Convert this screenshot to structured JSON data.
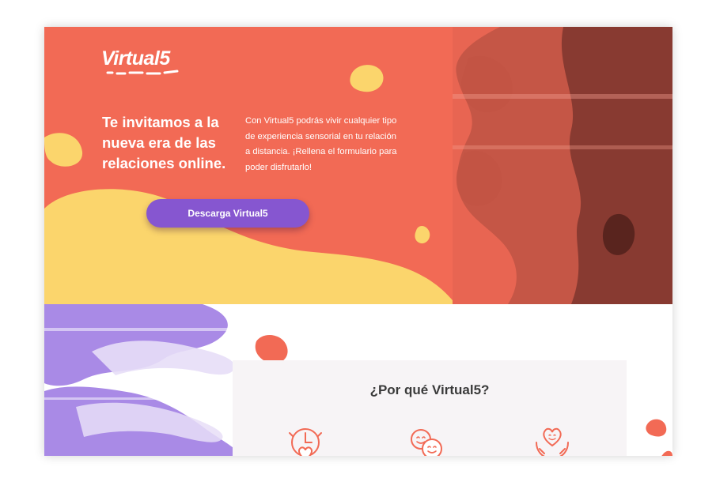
{
  "brand": {
    "name": "Virtual5"
  },
  "hero": {
    "headline": "Te invitamos a la nueva era de las relaciones online.",
    "intro": "Con Virtual5 podrás vivir cualquier tipo de experiencia sensorial en tu relación a distancia. ¡Rellena el formulario para poder disfrutarlo!",
    "cta_label": "Descarga Virtual5"
  },
  "why": {
    "title": "¿Por qué Virtual5?",
    "features": [
      {
        "icon": "clock-heart-icon"
      },
      {
        "icon": "smiling-faces-icon"
      },
      {
        "icon": "heart-hands-icon"
      }
    ]
  },
  "colors": {
    "coral": "#f26a55",
    "yellow": "#fbd56c",
    "purple": "#8656d0",
    "lavender": "#a98ae6",
    "dark_text": "#3a3a3a"
  }
}
